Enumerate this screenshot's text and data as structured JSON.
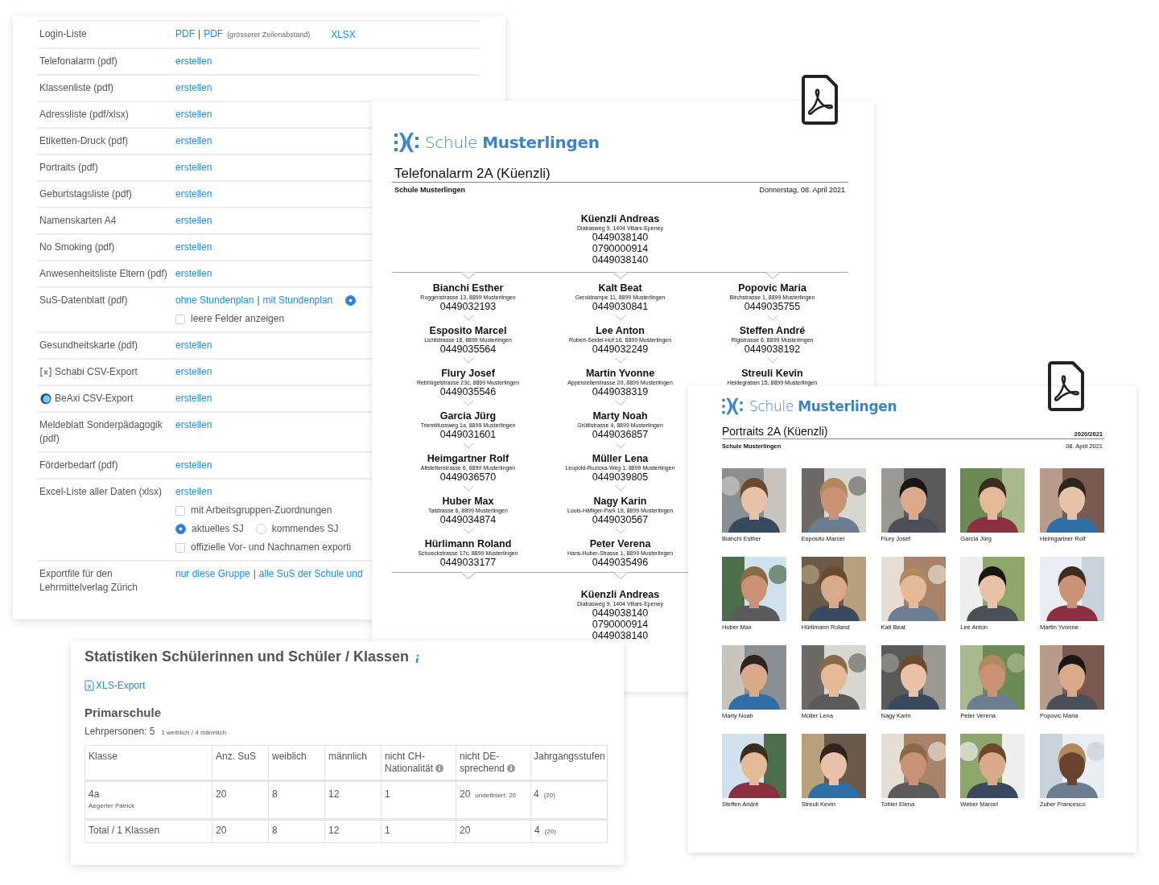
{
  "export_list": {
    "rows": [
      {
        "label": "Login-Liste",
        "groups": [
          {
            "separator": "|",
            "links": [
              {
                "text": "PDF"
              },
              {
                "text": "PDF",
                "note": "(grösserer Zeilenabstand)"
              }
            ]
          },
          {
            "links": [
              {
                "text": "XLSX"
              }
            ]
          }
        ]
      },
      {
        "label": "Telefonalarm (pdf)",
        "groups": [
          {
            "links": [
              {
                "text": "erstellen"
              }
            ]
          }
        ]
      },
      {
        "label": "Klassenliste (pdf)",
        "groups": [
          {
            "links": [
              {
                "text": "erstellen"
              }
            ]
          }
        ]
      },
      {
        "label": "Adressliste (pdf/xlsx)",
        "groups": [
          {
            "links": [
              {
                "text": "erstellen"
              }
            ]
          }
        ]
      },
      {
        "label": "Etiketten-Druck (pdf)",
        "groups": [
          {
            "links": [
              {
                "text": "erstellen"
              }
            ]
          }
        ]
      },
      {
        "label": "Portraits (pdf)",
        "groups": [
          {
            "links": [
              {
                "text": "erstellen"
              }
            ]
          }
        ]
      },
      {
        "label": "Geburtstagsliste (pdf)",
        "groups": [
          {
            "links": [
              {
                "text": "erstellen"
              }
            ]
          }
        ]
      },
      {
        "label": "Namenskarten A4",
        "groups": [
          {
            "links": [
              {
                "text": "erstellen"
              }
            ]
          }
        ]
      },
      {
        "label": "No Smoking (pdf)",
        "groups": [
          {
            "links": [
              {
                "text": "erstellen"
              }
            ]
          }
        ]
      },
      {
        "label": "Anwesenheitsliste Eltern (pdf)",
        "groups": [
          {
            "links": [
              {
                "text": "erstellen"
              }
            ]
          }
        ]
      },
      {
        "label": "SuS-Datenblatt (pdf)",
        "groups": [
          {
            "separator": "|",
            "links": [
              {
                "text": "ohne Stundenplan"
              },
              {
                "text": "mit Stundenplan"
              }
            ]
          }
        ],
        "radio": {
          "selected": true
        },
        "options": [
          {
            "kind": "checkbox",
            "label": "leere Felder anzeigen",
            "checked": false
          }
        ]
      },
      {
        "label": "Gesundheitskarte (pdf)",
        "groups": [
          {
            "links": [
              {
                "text": "erstellen"
              }
            ]
          }
        ]
      },
      {
        "label": "Schabi CSV-Export",
        "groups": [
          {
            "links": [
              {
                "text": "erstellen"
              }
            ]
          }
        ]
      },
      {
        "label": "BeAxi CSV-Export",
        "groups": [
          {
            "links": [
              {
                "text": "erstellen"
              }
            ]
          }
        ]
      },
      {
        "label": "Meldeblatt Sonderpädagogik (pdf)",
        "groups": [
          {
            "links": [
              {
                "text": "erstellen"
              }
            ]
          }
        ]
      },
      {
        "label": "Förderbedarf (pdf)",
        "groups": [
          {
            "links": [
              {
                "text": "erstellen"
              }
            ]
          }
        ]
      },
      {
        "label": "Excel-Liste aller Daten (xlsx)",
        "groups": [
          {
            "links": [
              {
                "text": "erstellen"
              }
            ]
          }
        ],
        "options": [
          {
            "kind": "checkbox",
            "label": "mit Arbeitsgruppen-Zuordnungen",
            "checked": false
          },
          {
            "kind": "radios",
            "items": [
              {
                "label": "aktuelles SJ",
                "selected": true
              },
              {
                "label": "kommendes SJ",
                "selected": false
              }
            ]
          },
          {
            "kind": "checkbox",
            "label": "offizielle Vor- und Nachnamen exporti",
            "checked": false
          }
        ]
      },
      {
        "label": "Exportfile für den Lehrmittelverlag Zürich",
        "groups": [
          {
            "separator": "|",
            "links": [
              {
                "text": "nur diese Gruppe"
              },
              {
                "text": "alle SuS der Schule und"
              }
            ]
          }
        ]
      }
    ]
  },
  "telefonalarm": {
    "logo": "Schule **Musterlingen**",
    "title": "Telefonalarm 2A (Küenzli)",
    "school": "Schule Musterlingen",
    "date": "Donnerstag, 08. April 2021",
    "head": {
      "name": "Küenzli Andreas",
      "address": "Diabasweg 9, 1404 Villars-Epeney",
      "phones": [
        "0449038140",
        "0790000914",
        "0449038140"
      ]
    },
    "columns": [
      [
        {
          "name": "Bianchi Esther",
          "address": "Roggenstrasse 13, 8899 Musterlingen",
          "phones": [
            "0449032193"
          ]
        },
        {
          "name": "Esposito Marcel",
          "address": "Lichtstrasse 18, 8899 Musterlingen",
          "phones": [
            "0449035564"
          ]
        },
        {
          "name": "Flury Josef",
          "address": "Rebhügelstrasse 23c, 8899 Musterlingen",
          "phones": [
            "0449035546"
          ]
        },
        {
          "name": "Garcia Jürg",
          "address": "Triemlifussweg 1a, 8899 Musterlingen",
          "phones": [
            "0449031601"
          ]
        },
        {
          "name": "Heimgartner Rolf",
          "address": "Altstetterstrasse 6, 8899 Musterlingen",
          "phones": [
            "0449036570"
          ]
        },
        {
          "name": "Huber Max",
          "address": "Talstrasse 6, 8899 Musterlingen",
          "phones": [
            "0449034874"
          ]
        },
        {
          "name": "Hürlimann Roland",
          "address": "Schoeckstrasse 17c, 8899 Musterlingen",
          "phones": [
            "0449033177"
          ]
        }
      ],
      [
        {
          "name": "Kalt Beat",
          "address": "Geroldrampe 11, 8899 Musterlingen",
          "phones": [
            "0449030841"
          ]
        },
        {
          "name": "Lee Anton",
          "address": "Robert-Seidel-Hof 16, 8899 Musterlingen",
          "phones": [
            "0449032249"
          ]
        },
        {
          "name": "Martin Yvonne",
          "address": "Appenzellerstrasse 20, 8899 Musterlingen",
          "phones": [
            "0449038319"
          ]
        },
        {
          "name": "Marty Noah",
          "address": "Grütlistrasse 4, 8899 Musterlingen",
          "phones": [
            "0449036857"
          ]
        },
        {
          "name": "Müller Lena",
          "address": "Leopold-Ruzicka-Weg 1, 8899 Musterlingen",
          "phones": [
            "0449039805"
          ]
        },
        {
          "name": "Nagy Karin",
          "address": "Louis-Häfliger-Park 19, 8899 Musterlingen",
          "phones": [
            "0449030567"
          ]
        },
        {
          "name": "Peter Verena",
          "address": "Hans-Huber-Strasse 1, 8899 Musterlingen",
          "phones": [
            "0449035496"
          ]
        }
      ],
      [
        {
          "name": "Popovic Maria",
          "address": "Birchstrasse 1, 8899 Musterlingen",
          "phones": [
            "0449035755"
          ]
        },
        {
          "name": "Steffen André",
          "address": "Rigistrasse 6, 8899 Musterlingen",
          "phones": [
            "0449038192"
          ]
        },
        {
          "name": "Streuli Kevin",
          "address": "Heidegraben 15, 8899 Musterlingen"
        }
      ]
    ],
    "footer": {
      "name": "Küenzli Andreas",
      "address": "Diabasweg 9, 1404 Villars-Epeney",
      "phones": [
        "0449038140",
        "0790000914",
        "0449038140"
      ]
    }
  },
  "portraits": {
    "logo": "Schule **Musterlingen**",
    "title": "Portraits 2A (Küenzli)",
    "year": "2020/2021",
    "school": "Schule Musterlingen",
    "date": "08. April 2021",
    "students": [
      {
        "name": "Bianchi Esther"
      },
      {
        "name": "Esposito Marcel"
      },
      {
        "name": "Flury Josef"
      },
      {
        "name": "Garcia Jürg"
      },
      {
        "name": "Heimgartner Rolf"
      },
      {
        "name": "Huber Max"
      },
      {
        "name": "Hürlimann Roland"
      },
      {
        "name": "Kalt Beat"
      },
      {
        "name": "Lee Anton"
      },
      {
        "name": "Martin Yvonne"
      },
      {
        "name": "Marty Noah"
      },
      {
        "name": "Müller Lena"
      },
      {
        "name": "Nagy Karin"
      },
      {
        "name": "Peter Verena"
      },
      {
        "name": "Popovic Maria"
      },
      {
        "name": "Steffen André"
      },
      {
        "name": "Streuli Kevin"
      },
      {
        "name": "Tobler Elena"
      },
      {
        "name": "Weber Marcel"
      },
      {
        "name": "Zuber Francesco"
      }
    ]
  },
  "statistics": {
    "title": "Statistiken Schülerinnen und Schüler / Klassen",
    "export_link": "XLS-Export",
    "section": "Primarschule",
    "teachers": "Lehrpersonen: 5",
    "teachers_detail": "1 weiblich / 4 männlich",
    "table": {
      "columns": [
        {
          "label": "Klasse",
          "info": false
        },
        {
          "label": "Anz. SuS",
          "info": false
        },
        {
          "label": "weiblich",
          "info": false
        },
        {
          "label": "männlich",
          "info": false
        },
        {
          "label": "nicht CH-Nationalität",
          "info": true
        },
        {
          "label": "nicht DE-sprechend",
          "info": true
        },
        {
          "label": "Jahrgangsstufen",
          "info": false
        }
      ],
      "rows": [
        {
          "cells": [
            {
              "text": "4a",
              "sub": "Aegerter Patrick"
            },
            {
              "text": "20"
            },
            {
              "text": "8"
            },
            {
              "text": "12"
            },
            {
              "text": "1"
            },
            {
              "text": "20",
              "note": "undefiniert: 20"
            },
            {
              "text": "4",
              "note": "(20)"
            }
          ]
        },
        {
          "cells": [
            {
              "text": "Total / 1 Klassen"
            },
            {
              "text": "20"
            },
            {
              "text": "8"
            },
            {
              "text": "12"
            },
            {
              "text": "1"
            },
            {
              "text": "20"
            },
            {
              "text": "4",
              "note": "(20)"
            }
          ]
        }
      ]
    }
  }
}
